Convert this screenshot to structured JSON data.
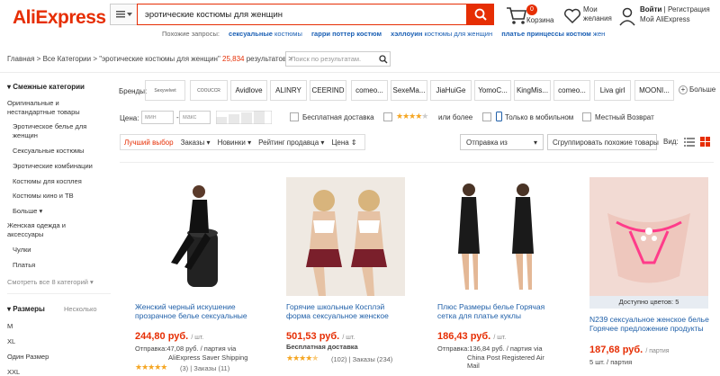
{
  "header": {
    "logo": "AliExpress",
    "search_value": "эротические костюмы для женщин",
    "related_label": "Похожие запросы:",
    "related": [
      {
        "bold": "сексуальные",
        "rest": "костюмы"
      },
      {
        "bold": "гарри поттер костюм",
        "rest": ""
      },
      {
        "bold": "хэллоуин",
        "rest": "костюмы для женщин"
      },
      {
        "bold": "платье принцессы костюм",
        "rest": "жен"
      }
    ],
    "cart_count": "0",
    "cart_label": "Корзина",
    "wish_line1": "Мои",
    "wish_line2": "желания",
    "signin": "Войти",
    "register": "Регистрация",
    "my_account": "Мой AliExpress"
  },
  "breadcrumb": {
    "home": "Главная",
    "all": "Все Категории",
    "query": "\"эротические костюмы для женщин\"",
    "count": "25,834",
    "results": "результатов",
    "search_placeholder": "Поиск по результатам."
  },
  "sidebar": {
    "related_title": "Смежные категории",
    "categories": [
      {
        "label": "Оригинальные и",
        "sub": false
      },
      {
        "label": "нестандартные товары",
        "sub": false
      },
      {
        "label": "Эротическое белье для",
        "sub": true
      },
      {
        "label": "женщин",
        "sub": true
      },
      {
        "label": "Сексуальные костюмы",
        "sub": true
      },
      {
        "label": "Эротические комбинации",
        "sub": true
      },
      {
        "label": "Костюмы для косплея",
        "sub": true
      },
      {
        "label": "Костюмы кино и ТВ",
        "sub": true
      },
      {
        "label": "Больше",
        "sub": true
      },
      {
        "label": "Женская одежда и",
        "sub": false
      },
      {
        "label": "аксессуары",
        "sub": false
      },
      {
        "label": "Чулки",
        "sub": true
      },
      {
        "label": "Платья",
        "sub": true
      }
    ],
    "see_all": "Смотреть все 8 категорий",
    "sizes_title": "Размеры",
    "sizes_multi": "Несколько",
    "sizes": [
      "M",
      "XL",
      "Один Размер",
      "XXL"
    ]
  },
  "brands": {
    "label": "Бренды:",
    "items": [
      "Sexyvelvet",
      "COOUCCR",
      "Avidlove",
      "ALINRY",
      "CEERIND",
      "comeo...",
      "SexeMa...",
      "JiaHuiGe",
      "YomoC...",
      "KingMis...",
      "comeo...",
      "Liva girl",
      "MOONI..."
    ],
    "more": "Больше"
  },
  "filters": {
    "price_label": "Цена:",
    "price_min": "мин",
    "price_max": "макс",
    "dash": "-",
    "free_shipping": "Бесплатная доставка",
    "rating_more": "или более",
    "mobile_only": "Только в мобильном",
    "local_return": "Местный Возврат"
  },
  "sort": {
    "best": "Лучший выбор",
    "orders": "Заказы",
    "new": "Новинки",
    "seller_rating": "Рейтинг продавца",
    "price": "Цена",
    "ship_from": "Отправка из",
    "group_similar": "Сгруппировать похожие товары",
    "view_label": "Вид:"
  },
  "products": [
    {
      "title1": "Женский черный искушение",
      "title2": "прозрачное белье сексуальные",
      "price": "244,80 руб.",
      "unit": "/ шт.",
      "ship1": "Отправка:47,08 руб. / партия via",
      "ship2": "AliExpress Saver Shipping",
      "reviews": "(3)",
      "orders": "Заказы (11)",
      "rating": 5
    },
    {
      "title1": "Горячие школьные Косплэй",
      "title2": "форма сексуальное женское",
      "price": "501,53 руб.",
      "unit": "/ шт.",
      "ship1": "Бесплатная доставка",
      "ship2": "",
      "reviews": "(102)",
      "orders": "Заказы (234)",
      "rating": 4.5
    },
    {
      "title1": "Плюс Размеры белье Горячая",
      "title2": "сетка для платье куклы",
      "price": "186,43 руб.",
      "unit": "/ шт.",
      "ship1": "Отправка:136,84 руб. / партия via",
      "ship2": "China Post Registered Air",
      "ship3": "Mail",
      "rating": 0
    },
    {
      "badge": "Доступно цветов: 5",
      "title1": "N239 сексуальное женское белье",
      "title2": "Горячее предложение продукты",
      "price": "187,68 руб.",
      "unit": "/ партия",
      "ship1": "5 шт. / партия",
      "rating": 0
    }
  ],
  "colors": {
    "accent": "#e62e04",
    "link": "#1f5fa8",
    "star": "#f5a623"
  }
}
